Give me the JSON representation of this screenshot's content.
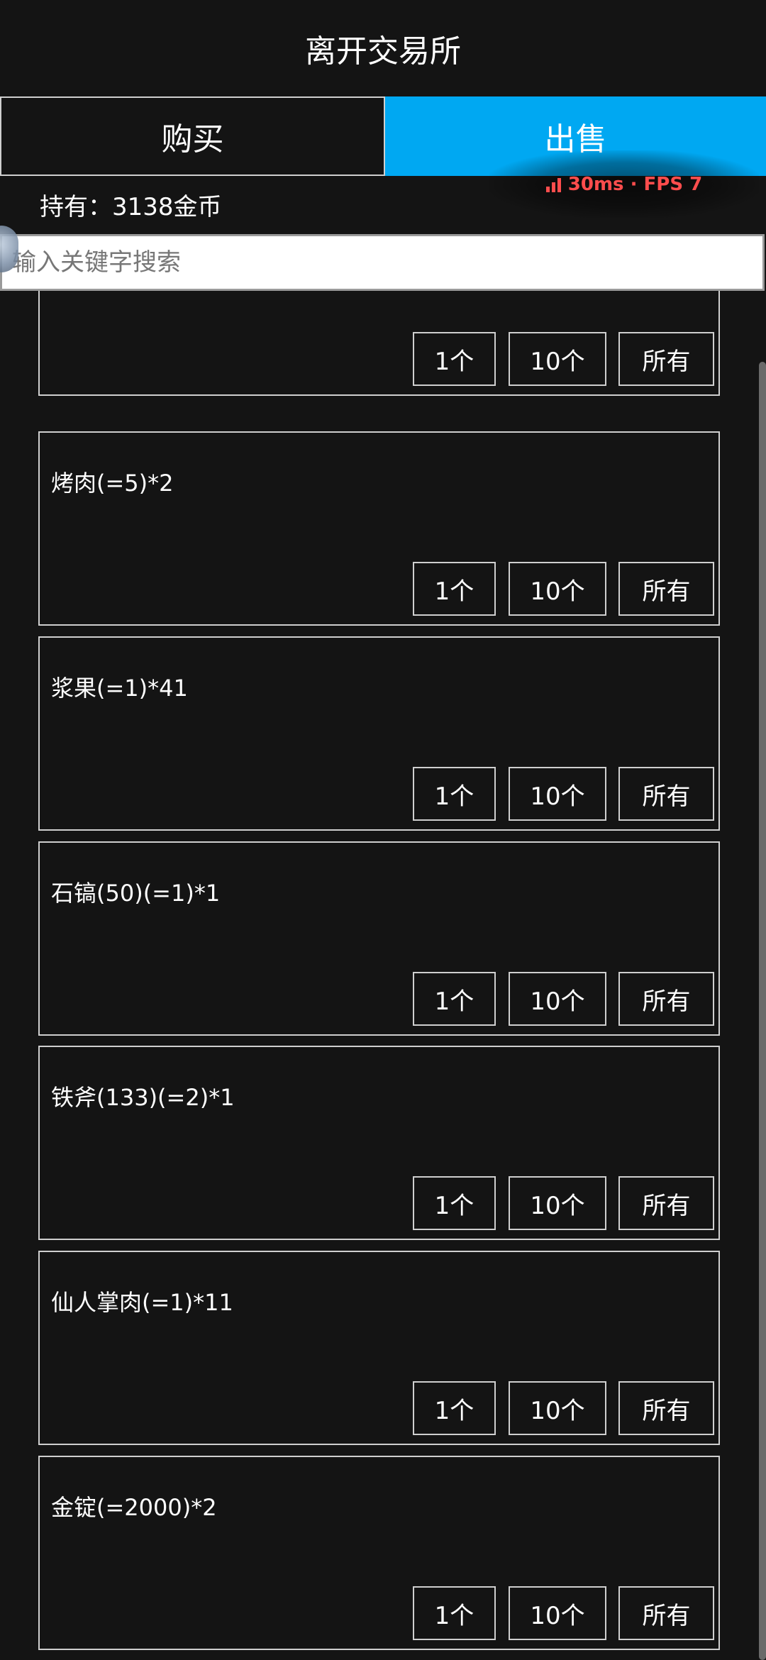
{
  "header": {
    "title": "离开交易所"
  },
  "tabs": {
    "buy": "购买",
    "sell": "出售"
  },
  "overlay": {
    "stats": "30ms · FPS 7"
  },
  "wallet": {
    "holdings": "持有：3138金币"
  },
  "search": {
    "placeholder": "输入关键字搜索",
    "value": ""
  },
  "actions": {
    "one": "1个",
    "ten": "10个",
    "all": "所有"
  },
  "items": [
    {
      "name": ""
    },
    {
      "name": "烤肉(=5)*2"
    },
    {
      "name": "浆果(=1)*41"
    },
    {
      "name": "石镐(50)(=1)*1"
    },
    {
      "name": "铁斧(133)(=2)*1"
    },
    {
      "name": "仙人掌肉(=1)*11"
    },
    {
      "name": "金锭(=2000)*2"
    }
  ],
  "colors": {
    "background": "#141414",
    "accent": "#00a8f2",
    "overlay_text": "#ff4d4d"
  }
}
